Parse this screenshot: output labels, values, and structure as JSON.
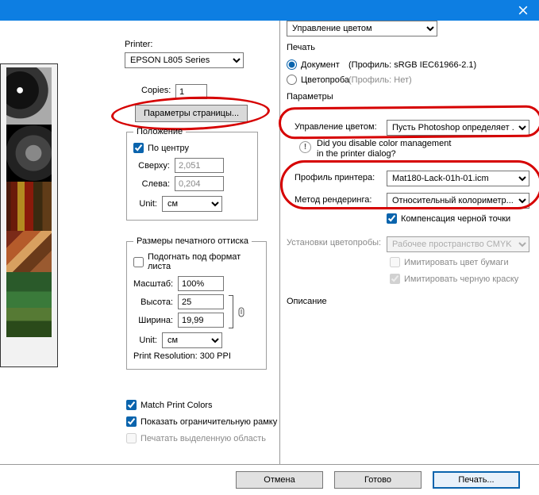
{
  "titlebar": {
    "close_icon": "×"
  },
  "left": {
    "printer_label": "Printer:",
    "printer_value": "EPSON L805 Series",
    "copies_label": "Copies:",
    "copies_value": "1",
    "page_setup_btn": "Параметры страницы...",
    "position": {
      "legend": "Положение",
      "center_label": "По центру",
      "top_label": "Сверху:",
      "top_value": "2,051",
      "left_label": "Слева:",
      "left_value": "0,204",
      "unit_label": "Unit:",
      "unit_value": "см"
    },
    "print_size": {
      "legend": "Размеры печатного оттиска",
      "fit_label": "Подогнать под формат листа",
      "scale_label": "Масштаб:",
      "scale_value": "100%",
      "height_label": "Высота:",
      "height_value": "25",
      "width_label": "Ширина:",
      "width_value": "19,99",
      "unit_label": "Unit:",
      "unit_value": "см",
      "resolution_label": "Print Resolution: 300 PPI"
    },
    "match_colors_label": "Match Print Colors",
    "bounding_box_label": "Показать ограничительную рамку",
    "print_selection_label": "Печатать выделенную область"
  },
  "right": {
    "top_select_value": "Управление цветом",
    "print_label": "Печать",
    "doc_label": "Документ",
    "doc_profile": "(Профиль: sRGB IEC61966-2.1)",
    "proof_label": "Цветопроба",
    "proof_profile": "(Профиль: Нет)",
    "params_label": "Параметры",
    "color_handling_label": "Управление цветом:",
    "color_handling_value": "Пусть Photoshop определяет ...",
    "warn_line1": "Did you disable color management",
    "warn_line2": "in the printer dialog?",
    "printer_profile_label": "Профиль принтера:",
    "printer_profile_value": "Mat180-Lack-01h-01.icm",
    "rendering_label": "Метод рендеринга:",
    "rendering_value": "Относительный колориметр...",
    "black_point_label": "Компенсация черной точки",
    "proof_setup_label": "Установки цветопробы:",
    "proof_setup_value": "Рабочее пространство CMYK",
    "sim_paper_label": "Имитировать цвет бумаги",
    "sim_black_label": "Имитировать черную краску",
    "description_label": "Описание"
  },
  "buttons": {
    "cancel": "Отмена",
    "done": "Готово",
    "print": "Печать..."
  }
}
